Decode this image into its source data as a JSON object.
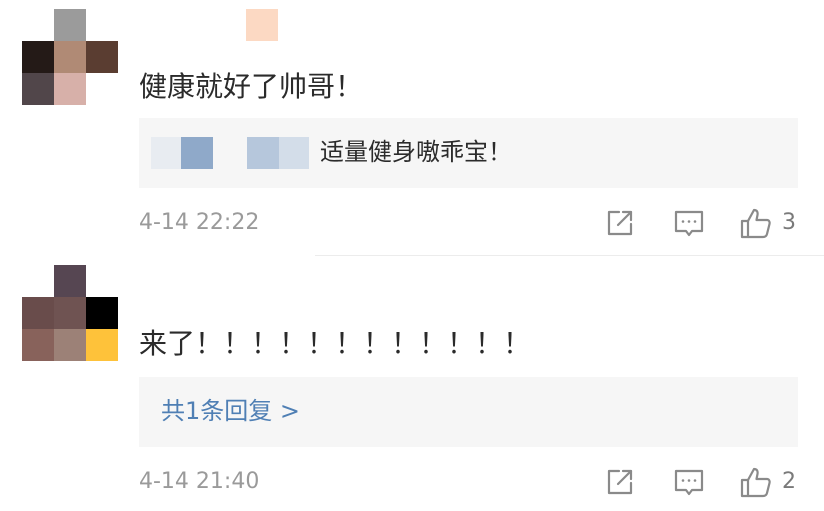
{
  "comments": [
    {
      "text": "健康就好了帅哥！",
      "reply": {
        "text": "适量健身嗷乖宝！"
      },
      "time": "4-14 22:22",
      "likes": "3",
      "avatar_colors": [
        "#9b9b9b",
        "#241a17",
        "#b08a75",
        "#5a3d31",
        "#51464a",
        "#d7b0a9"
      ]
    },
    {
      "text": "来了！！！！！！！！！！！！",
      "reply_link": "共1条回复 >",
      "time": "4-14 21:40",
      "likes": "2",
      "avatar_colors": [
        "#564652",
        "#694c4b",
        "#6f5352",
        "#000000",
        "#88625b",
        "#9c8177",
        "#fec23a"
      ]
    }
  ],
  "icons": {
    "share": "share-icon",
    "comment": "comment-icon",
    "like": "like-icon"
  },
  "colors": {
    "link": "#4f7fb4",
    "muted": "#9a9a9a",
    "reply_bg": "#f6f6f6"
  }
}
